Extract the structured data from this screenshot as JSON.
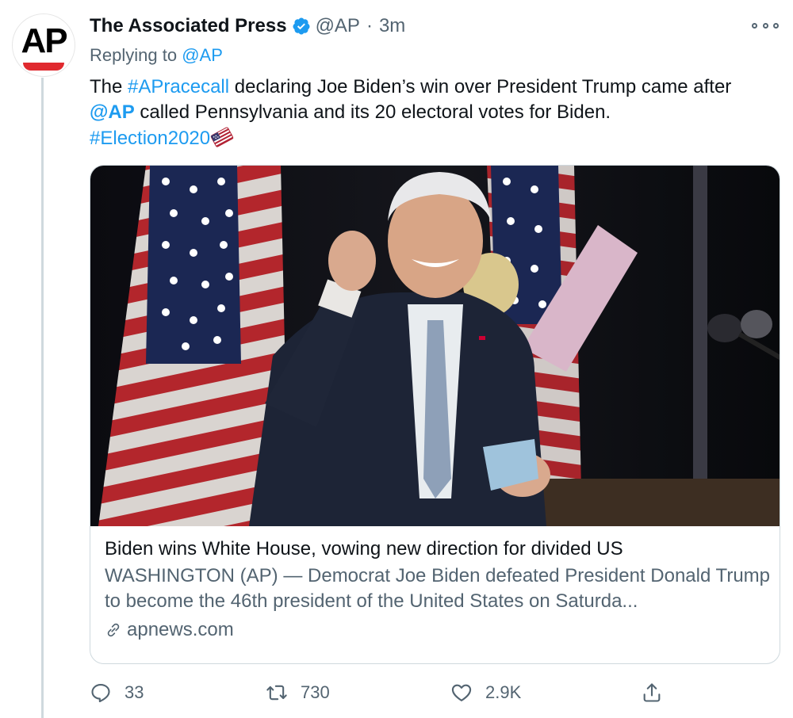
{
  "tweet": {
    "name": "The Associated Press",
    "handle": "@AP",
    "dot": "·",
    "time": "3m",
    "replying_prefix": "Replying to",
    "replying_handle": "@AP",
    "avatar_text": "AP",
    "text_part1": "The ",
    "hashtag1": "#APracecall",
    "text_part2": " declaring Joe Biden’s win over President Trump came after ",
    "mention": "@AP",
    "text_part3": " called Pennsylvania and its 20 electoral votes for Biden.",
    "hashtag2": "#Election2020"
  },
  "card": {
    "title": "Biden wins White House, vowing new direction for divided US",
    "description": "WASHINGTON (AP) — Democrat Joe Biden defeated President Donald Trump to become the 46th president of the United States on Saturda...",
    "domain": "apnews.com"
  },
  "actions": {
    "replies": "33",
    "retweets": "730",
    "likes": "2.9K"
  },
  "icons": {
    "verified": "verified-badge-icon",
    "more": "more-options-icon",
    "reply": "reply-icon",
    "retweet": "retweet-icon",
    "like": "heart-icon",
    "share": "share-icon",
    "link": "link-icon"
  },
  "colors": {
    "accent": "#1d9bf0",
    "secondary_text": "#536471",
    "ap_red": "#e0292e"
  }
}
